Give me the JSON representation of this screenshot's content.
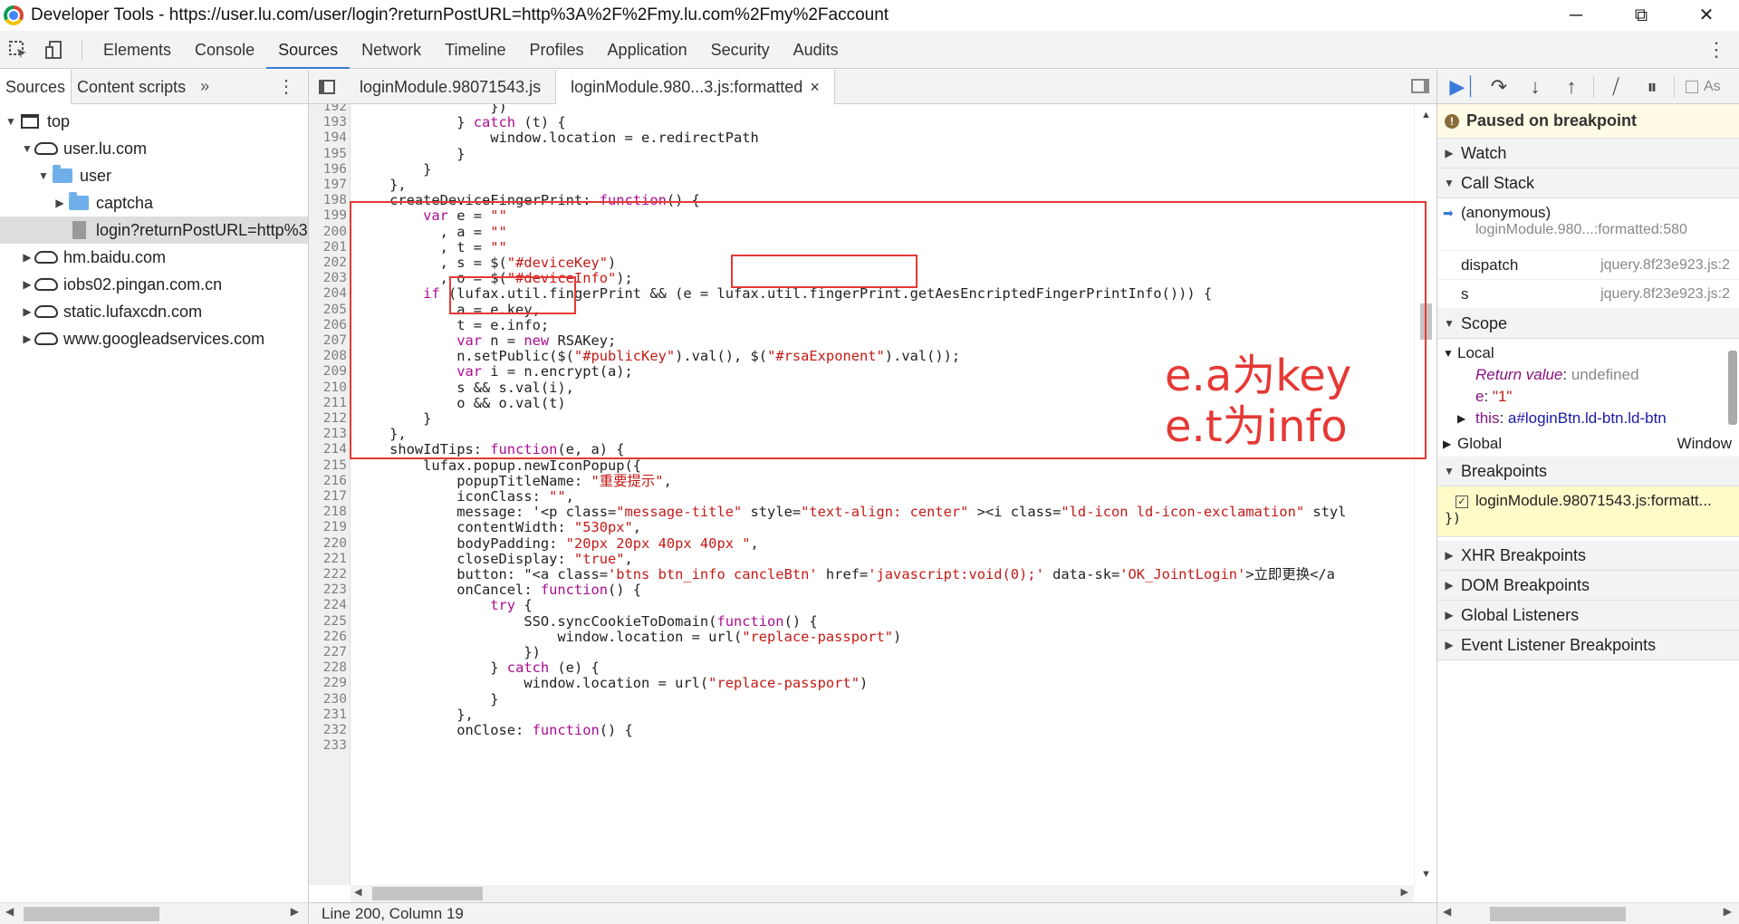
{
  "window": {
    "title": "Developer Tools - https://user.lu.com/user/login?returnPostURL=http%3A%2F%2Fmy.lu.com%2Fmy%2Faccount",
    "minimize": "─",
    "maximize": "⧉",
    "close": "✕"
  },
  "main_tabs": [
    "Elements",
    "Console",
    "Sources",
    "Network",
    "Timeline",
    "Profiles",
    "Application",
    "Security",
    "Audits"
  ],
  "active_main_tab": "Sources",
  "navigator": {
    "tabs": [
      "Sources",
      "Content scripts"
    ],
    "more": "»",
    "tree": [
      {
        "label": "top",
        "depth": 0,
        "icon": "top-frame-icon",
        "expanded": true
      },
      {
        "label": "user.lu.com",
        "depth": 1,
        "icon": "cloud-icon",
        "expanded": true
      },
      {
        "label": "user",
        "depth": 2,
        "icon": "folder-icon",
        "expanded": true
      },
      {
        "label": "captcha",
        "depth": 3,
        "icon": "folder-icon",
        "expanded": false
      },
      {
        "label": "login?returnPostURL=http%3",
        "depth": 3,
        "icon": "file-icon",
        "selected": true
      },
      {
        "label": "hm.baidu.com",
        "depth": 1,
        "icon": "cloud-icon",
        "expanded": false
      },
      {
        "label": "iobs02.pingan.com.cn",
        "depth": 1,
        "icon": "cloud-icon",
        "expanded": false
      },
      {
        "label": "static.lufaxcdn.com",
        "depth": 1,
        "icon": "cloud-icon",
        "expanded": false
      },
      {
        "label": "www.googleadservices.com",
        "depth": 1,
        "icon": "cloud-icon",
        "expanded": false
      }
    ]
  },
  "editor": {
    "tabs": [
      "loginModule.98071543.js",
      "loginModule.980...3.js:formatted"
    ],
    "active_tab": 1,
    "close_glyph": "×",
    "status": "Line 200, Column 19",
    "lines": [
      {
        "n": "192",
        "code": "                })"
      },
      {
        "n": "193",
        "code": "            } catch (t) {"
      },
      {
        "n": "194",
        "code": "                window.location = e.redirectPath"
      },
      {
        "n": "195",
        "code": "            }"
      },
      {
        "n": "196",
        "code": "        }"
      },
      {
        "n": "197",
        "code": "    },"
      },
      {
        "n": "198",
        "code": "    createDeviceFingerPrint: function() {"
      },
      {
        "n": "199",
        "code": "        var e = \"\""
      },
      {
        "n": "200",
        "code": "          , a = \"\""
      },
      {
        "n": "201",
        "code": "          , t = \"\""
      },
      {
        "n": "202",
        "code": "          , s = $(\"#deviceKey\")"
      },
      {
        "n": "203",
        "code": "          , o = $(\"#deviceInfo\");"
      },
      {
        "n": "204",
        "code": "        if (lufax.util.fingerPrint && (e = lufax.util.fingerPrint.getAesEncriptedFingerPrintInfo())) {"
      },
      {
        "n": "205",
        "code": "            a = e.key,"
      },
      {
        "n": "206",
        "code": "            t = e.info;"
      },
      {
        "n": "207",
        "code": "            var n = new RSAKey;"
      },
      {
        "n": "208",
        "code": "            n.setPublic($(\"#publicKey\").val(), $(\"#rsaExponent\").val());"
      },
      {
        "n": "209",
        "code": "            var i = n.encrypt(a);"
      },
      {
        "n": "210",
        "code": "            s && s.val(i),"
      },
      {
        "n": "211",
        "code": "            o && o.val(t)"
      },
      {
        "n": "212",
        "code": "        }"
      },
      {
        "n": "213",
        "code": "    },"
      },
      {
        "n": "214",
        "code": "    showIdTips: function(e, a) {"
      },
      {
        "n": "215",
        "code": "        lufax.popup.newIconPopup({"
      },
      {
        "n": "216",
        "code": "            popupTitleName: \"重要提示\","
      },
      {
        "n": "217",
        "code": "            iconClass: \"\","
      },
      {
        "n": "218",
        "code": "            message: '<p class=\"message-title\" style=\"text-align: center\" ><i class=\"ld-icon ld-icon-exclamation\" styl"
      },
      {
        "n": "219",
        "code": "            contentWidth: \"530px\","
      },
      {
        "n": "220",
        "code": "            bodyPadding: \"20px 20px 40px 40px \","
      },
      {
        "n": "221",
        "code": "            closeDisplay: \"true\","
      },
      {
        "n": "222",
        "code": "            button: \"<a class='btns btn_info cancleBtn' href='javascript:void(0);' data-sk='OK_JointLogin'>立即更换</a"
      },
      {
        "n": "223",
        "code": "            onCancel: function() {"
      },
      {
        "n": "224",
        "code": "                try {"
      },
      {
        "n": "225",
        "code": "                    SSO.syncCookieToDomain(function() {"
      },
      {
        "n": "226",
        "code": "                        window.location = url(\"replace-passport\")"
      },
      {
        "n": "227",
        "code": "                    })"
      },
      {
        "n": "228",
        "code": "                } catch (e) {"
      },
      {
        "n": "229",
        "code": "                    window.location = url(\"replace-passport\")"
      },
      {
        "n": "230",
        "code": "                }"
      },
      {
        "n": "231",
        "code": "            },"
      },
      {
        "n": "232",
        "code": "            onClose: function() {"
      },
      {
        "n": "233",
        "code": ""
      }
    ]
  },
  "annotation": {
    "line1": "e.a为key",
    "line2": "e.t为info",
    "color": "#e53935"
  },
  "debugger": {
    "paused_text": "Paused on breakpoint",
    "watch": "Watch",
    "call_stack": "Call Stack",
    "frames": [
      {
        "name": "(anonymous)",
        "location": "loginModule.980...:formatted:580"
      },
      {
        "name": "dispatch",
        "location": "jquery.8f23e923.js:2"
      },
      {
        "name": "s",
        "location": "jquery.8f23e923.js:2"
      }
    ],
    "scope": "Scope",
    "local": "Local",
    "return_value_name": "Return value",
    "return_value": "undefined",
    "e_name": "e",
    "e_value": "\"1\"",
    "this_name": "this",
    "this_value": "a#loginBtn.ld-btn.ld-btn",
    "global": "Global",
    "global_value": "Window",
    "breakpoints": "Breakpoints",
    "breakpoint_item": "loginModule.98071543.js:formatt...",
    "breakpoint_snippet": "})",
    "xhr_breakpoints": "XHR Breakpoints",
    "dom_breakpoints": "DOM Breakpoints",
    "global_listeners": "Global Listeners",
    "event_listener_breakpoints": "Event Listener Breakpoints",
    "async_label": "As"
  }
}
